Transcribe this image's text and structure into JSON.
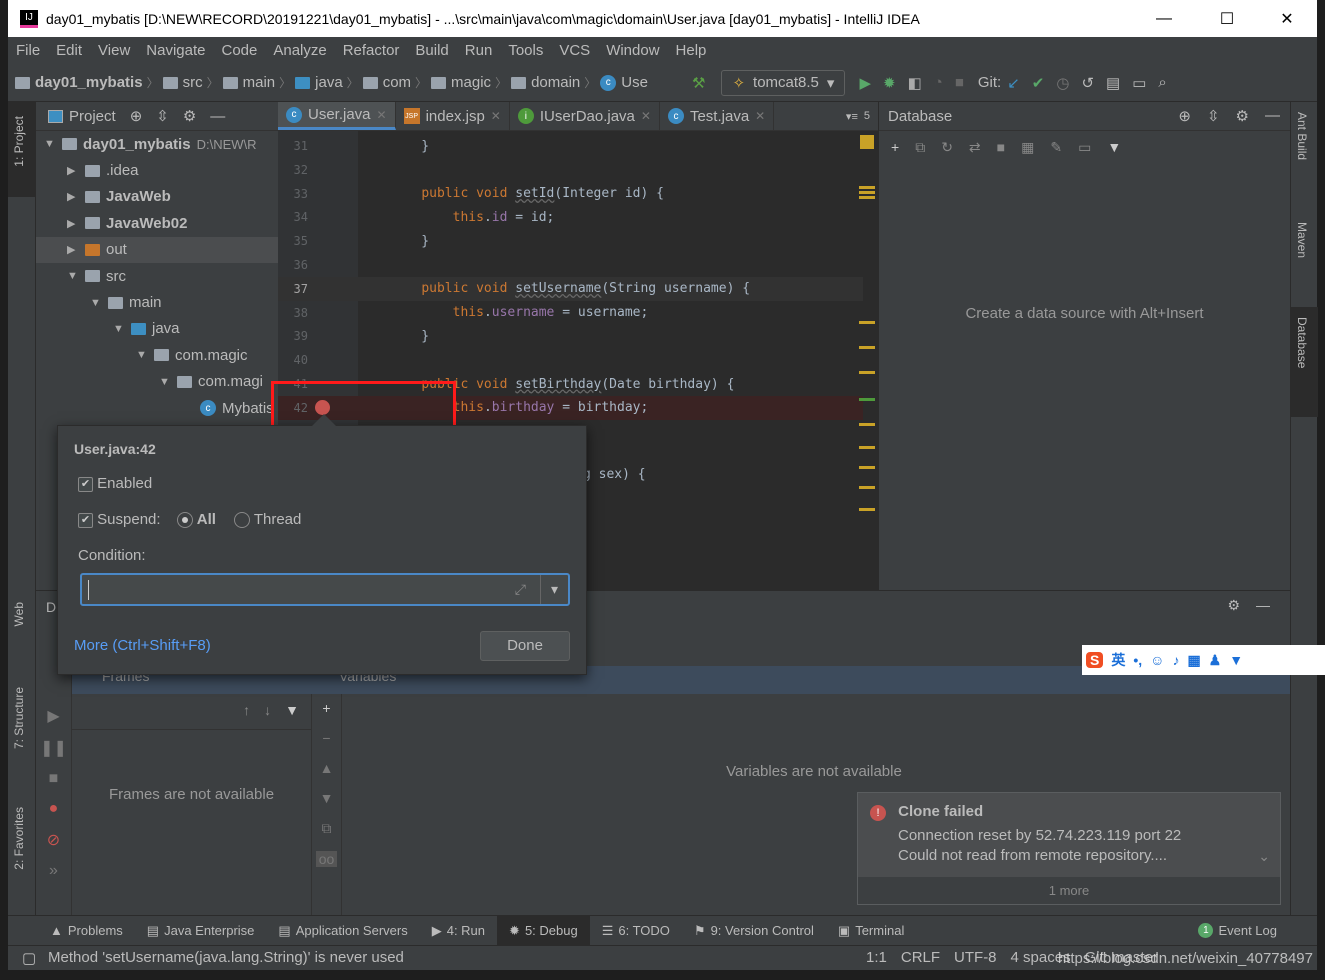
{
  "window": {
    "title": "day01_mybatis [D:\\NEW\\RECORD\\20191221\\day01_mybatis] - ...\\src\\main\\java\\com\\magic\\domain\\User.java [day01_mybatis] - IntelliJ IDEA",
    "minimize": "—",
    "maximize": "☐",
    "close": "✕"
  },
  "menu": [
    "File",
    "Edit",
    "View",
    "Navigate",
    "Code",
    "Analyze",
    "Refactor",
    "Build",
    "Run",
    "Tools",
    "VCS",
    "Window",
    "Help"
  ],
  "breadcrumb": [
    "day01_mybatis",
    "src",
    "main",
    "java",
    "com",
    "magic",
    "domain",
    "Use"
  ],
  "run_config": "tomcat8.5",
  "git_label": "Git:",
  "left_strip": {
    "project": "1: Project",
    "web": "Web",
    "structure": "7: Structure",
    "favorites": "2: Favorites"
  },
  "right_strip": {
    "ant": "Ant Build",
    "maven": "Maven",
    "database": "Database"
  },
  "project_panel": {
    "title": "Project",
    "tree": [
      {
        "label": "day01_mybatis",
        "extra": "D:\\NEW\\R",
        "indent": 0,
        "open": true,
        "bold": true
      },
      {
        "label": ".idea",
        "indent": 1,
        "open": false
      },
      {
        "label": "JavaWeb",
        "indent": 1,
        "open": false,
        "bold": true
      },
      {
        "label": "JavaWeb02",
        "indent": 1,
        "open": false,
        "bold": true
      },
      {
        "label": "out",
        "indent": 1,
        "open": false,
        "orange": true
      },
      {
        "label": "src",
        "indent": 1,
        "open": true
      },
      {
        "label": "main",
        "indent": 2,
        "open": true
      },
      {
        "label": "java",
        "indent": 3,
        "open": true,
        "blue": true
      },
      {
        "label": "com.magic",
        "indent": 4,
        "open": true
      },
      {
        "label": "com.magi",
        "indent": 5,
        "open": true
      },
      {
        "label": "Mybatis",
        "indent": 6,
        "leaf": true
      }
    ]
  },
  "editor_tabs": [
    {
      "label": "User.java",
      "icon": "C",
      "active": true
    },
    {
      "label": "index.jsp",
      "icon": "JSP"
    },
    {
      "label": "IUserDao.java",
      "icon": "I"
    },
    {
      "label": "Test.java",
      "icon": "C"
    }
  ],
  "tab_overflow": "5",
  "code_lines": [
    {
      "n": "31",
      "code": "    }"
    },
    {
      "n": "32",
      "code": ""
    },
    {
      "n": "33",
      "code": "    public void setId(Integer id) {"
    },
    {
      "n": "34",
      "code": "        this.id = id;"
    },
    {
      "n": "35",
      "code": "    }"
    },
    {
      "n": "36",
      "code": ""
    },
    {
      "n": "37",
      "code": "    public void setUsername(String username) {"
    },
    {
      "n": "38",
      "code": "        this.username = username;"
    },
    {
      "n": "39",
      "code": "    }"
    },
    {
      "n": "40",
      "code": ""
    },
    {
      "n": "41",
      "code": "    public void setBirthday(Date birthday) {"
    },
    {
      "n": "42",
      "code": "        this.birthday = birthday;"
    }
  ],
  "code_partial": "g sex) {",
  "database": {
    "title": "Database",
    "empty": "Create a data source with Alt+Insert"
  },
  "breakpoint_popup": {
    "title": "User.java:42",
    "enabled": "Enabled",
    "suspend": "Suspend:",
    "all": "All",
    "thread": "Thread",
    "condition": "Condition:",
    "condition_value": "",
    "more": "More (Ctrl+Shift+F8)",
    "done": "Done"
  },
  "debug": {
    "tab_letter": "D",
    "frames": "Frames",
    "variables": "Variables",
    "frames_empty": "Frames are not available",
    "variables_empty": "Variables are not available"
  },
  "notification": {
    "title": "Clone failed",
    "line1": "Connection reset by 52.74.223.119 port 22",
    "line2": "Could not read from remote repository....",
    "more": "1 more"
  },
  "bottom_tabs": [
    {
      "label": "Problems",
      "icon": "▲"
    },
    {
      "label": "Java Enterprise",
      "icon": "▤"
    },
    {
      "label": "Application Servers",
      "icon": "▤"
    },
    {
      "label": "4: Run",
      "icon": "▶"
    },
    {
      "label": "5: Debug",
      "icon": "✹",
      "active": true
    },
    {
      "label": "6: TODO",
      "icon": "☰"
    },
    {
      "label": "9: Version Control",
      "icon": "⚑"
    },
    {
      "label": "Terminal",
      "icon": "▣"
    }
  ],
  "event_log": {
    "label": "Event Log",
    "count": "1"
  },
  "status": {
    "message": "Method 'setUsername(java.lang.String)' is never used",
    "position": "1:1",
    "line_sep": "CRLF",
    "encoding": "UTF-8",
    "indent": "4 spaces",
    "git": "Git: master",
    "watermark": "https://blog.csdn.net/weixin_40778497"
  },
  "ime": {
    "lang": "英"
  },
  "colors": {
    "accent": "#4a88c7",
    "breakpoint": "#c75450",
    "highlight_box": "#ff0000",
    "error": "#c75450"
  }
}
